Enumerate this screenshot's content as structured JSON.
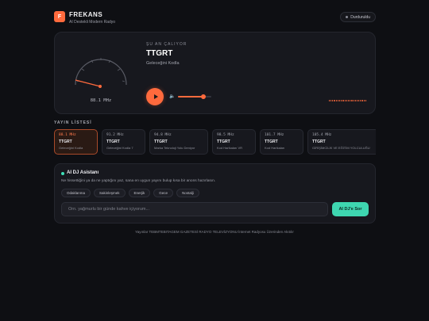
{
  "header": {
    "logo_letter": "F",
    "brand": "FREKANS",
    "subtitle": "AI Destekli Modern Radyo",
    "stop_label": "Durduruldu"
  },
  "player": {
    "now_label": "ŞU AN ÇALIYOR",
    "station": "TTGRT",
    "slogan": "Geleceğini Kodla",
    "frequency": "88.1 MHz",
    "volume_level": 0.75,
    "accent": "#ff6a3d"
  },
  "station_list": {
    "title": "YAYIN LİSTESİ",
    "stations": [
      {
        "freq": "88.1 MHz",
        "name": "TTGRT",
        "desc": "Geleceğini Kodla",
        "active": true
      },
      {
        "freq": "91.2 MHz",
        "name": "TTGRT",
        "desc": "Geleceğini Kodla 7",
        "active": false
      },
      {
        "freq": "94.8 MHz",
        "name": "TTGRT",
        "desc": "Marka Teknoloji Yolu Deniyor",
        "active": false
      },
      {
        "freq": "98.5 MHz",
        "name": "TTGRT",
        "desc": "Kod Harikaları VR",
        "active": false
      },
      {
        "freq": "101.7 MHz",
        "name": "TTGRT",
        "desc": "Kod Harikaları",
        "active": false
      },
      {
        "freq": "105.4 MHz",
        "name": "TTGRT",
        "desc": "GİRİŞİMCİLİK VE EĞİTİM YOLCULUĞU",
        "active": false
      }
    ]
  },
  "dj": {
    "title": "AI DJ Asistanı",
    "description": "Ne hissettiğini ya da ne yaptığını yaz, sana en uygun yayını bulup kısa bir anons hazırlasın.",
    "chips": [
      "Odaklanma",
      "Sakinleşmek",
      "Enerjik",
      "Gece",
      "Nostalji"
    ],
    "input_placeholder": "Örn. yağmurlu bir günde kahve içiyorum...",
    "button_label": "AI DJ'e Sor",
    "accent": "#3ed6b0"
  },
  "footer": {
    "text": "Yayınlar TEBMTEBITAGEM GAZETESİ RADYO TELEVİZYONU İnternet Radyosu Üzerinden Akıtılır"
  }
}
